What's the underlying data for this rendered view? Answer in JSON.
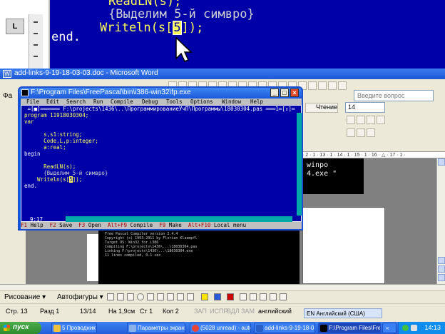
{
  "zoom": {
    "line1": "ReadLN(s);",
    "line2": "{Выделим 5-й симвро}",
    "line3_pre": "Writeln(s[",
    "line3_idx": "5",
    "line3_post": "]);",
    "line4": "end.",
    "button": "L"
  },
  "word": {
    "title": "add-links-9-19-18-03-03.doc - Microsoft Word",
    "menu_label": "Фа",
    "help_placeholder": "Введите вопрос",
    "reading_label": "Чтение",
    "font_size": "14",
    "ruler": "· 2 · 1 · 13 · 1 · 14 · 1 · 15 · 1 · 16 · △ · 17 · 1 ·",
    "console_lines": [
      "winpo",
      "4.exe \""
    ],
    "compile_console": "  Free Pascal Compiler version 2.4.4\n  Copyright (c) 1993-2011 by Florian Klaempfl\n  Target OS: Win32 for i386\n  Compiling F:\\projects\\1436\\...\\18030304.pas\n  Linking F:\\projects\\1436\\...\\18030304.exe\n  11 lines compiled, 0.1 sec\n",
    "draw_label": "Рисование ▾",
    "autoshapes_label": "Автофигуры ▾",
    "status": {
      "page": "Стр. 13",
      "section": "Разд 1",
      "pages": "13/14",
      "at": "На 1,9см",
      "line": "Ст 1",
      "col": "Кол 2",
      "rec": "ЗАП",
      "trk": "ИСПР",
      "ext": "ВДЛ",
      "ovr": "ЗАМ",
      "lang": "английский"
    },
    "lang_indicator": "EN Английский (США)"
  },
  "fp": {
    "title": "F:\\Program Files\\FreePascal\\bin\\i386-win32\\fp.exe",
    "menu": [
      "File",
      "Edit",
      "Search",
      "Run",
      "Compile",
      "Debug",
      "Tools",
      "Options",
      "Window",
      "Help"
    ],
    "editor_title": "=[■]══════ F:\\projects\\1436\\..\\ПрограммированиеУчП\\Программы\\18030304.pas ═══1═[↕]═",
    "code": {
      "l1": "program 11918030304;",
      "l2": "var",
      "l3": "      s,s1:string;",
      "l4": "      Code,L,p:integer;",
      "l5": "      a:real;",
      "l6": "begin",
      "l7": "      ReadLN(s);",
      "l8": "      {Выделим 5-й симвро}",
      "l9_pre": "    Writeln(s[",
      "l9_idx": "5",
      "l9_post": "]);",
      "l10": "end."
    },
    "position": "9:17",
    "status": {
      "f1": "F1",
      "f1_label": " Help  ",
      "f2": "F2",
      "f2_label": " Save  ",
      "f3": "F3",
      "f3_label": " Open  ",
      "af9": "Alt+F9",
      "af9_label": " Compile  ",
      "f9": "F9",
      "f9_label": " Make  ",
      "af10": "Alt+F10",
      "af10_label": " Local menu"
    }
  },
  "taskbar": {
    "start": "пуск",
    "tasks": [
      "5 Проводник",
      "Параметры экранно...",
      "(5028 unread) - auto...",
      "add-links-9-19-18-03-...",
      "F:\\Program Files\\Fre...",
      "«"
    ],
    "clock": "14:13"
  }
}
